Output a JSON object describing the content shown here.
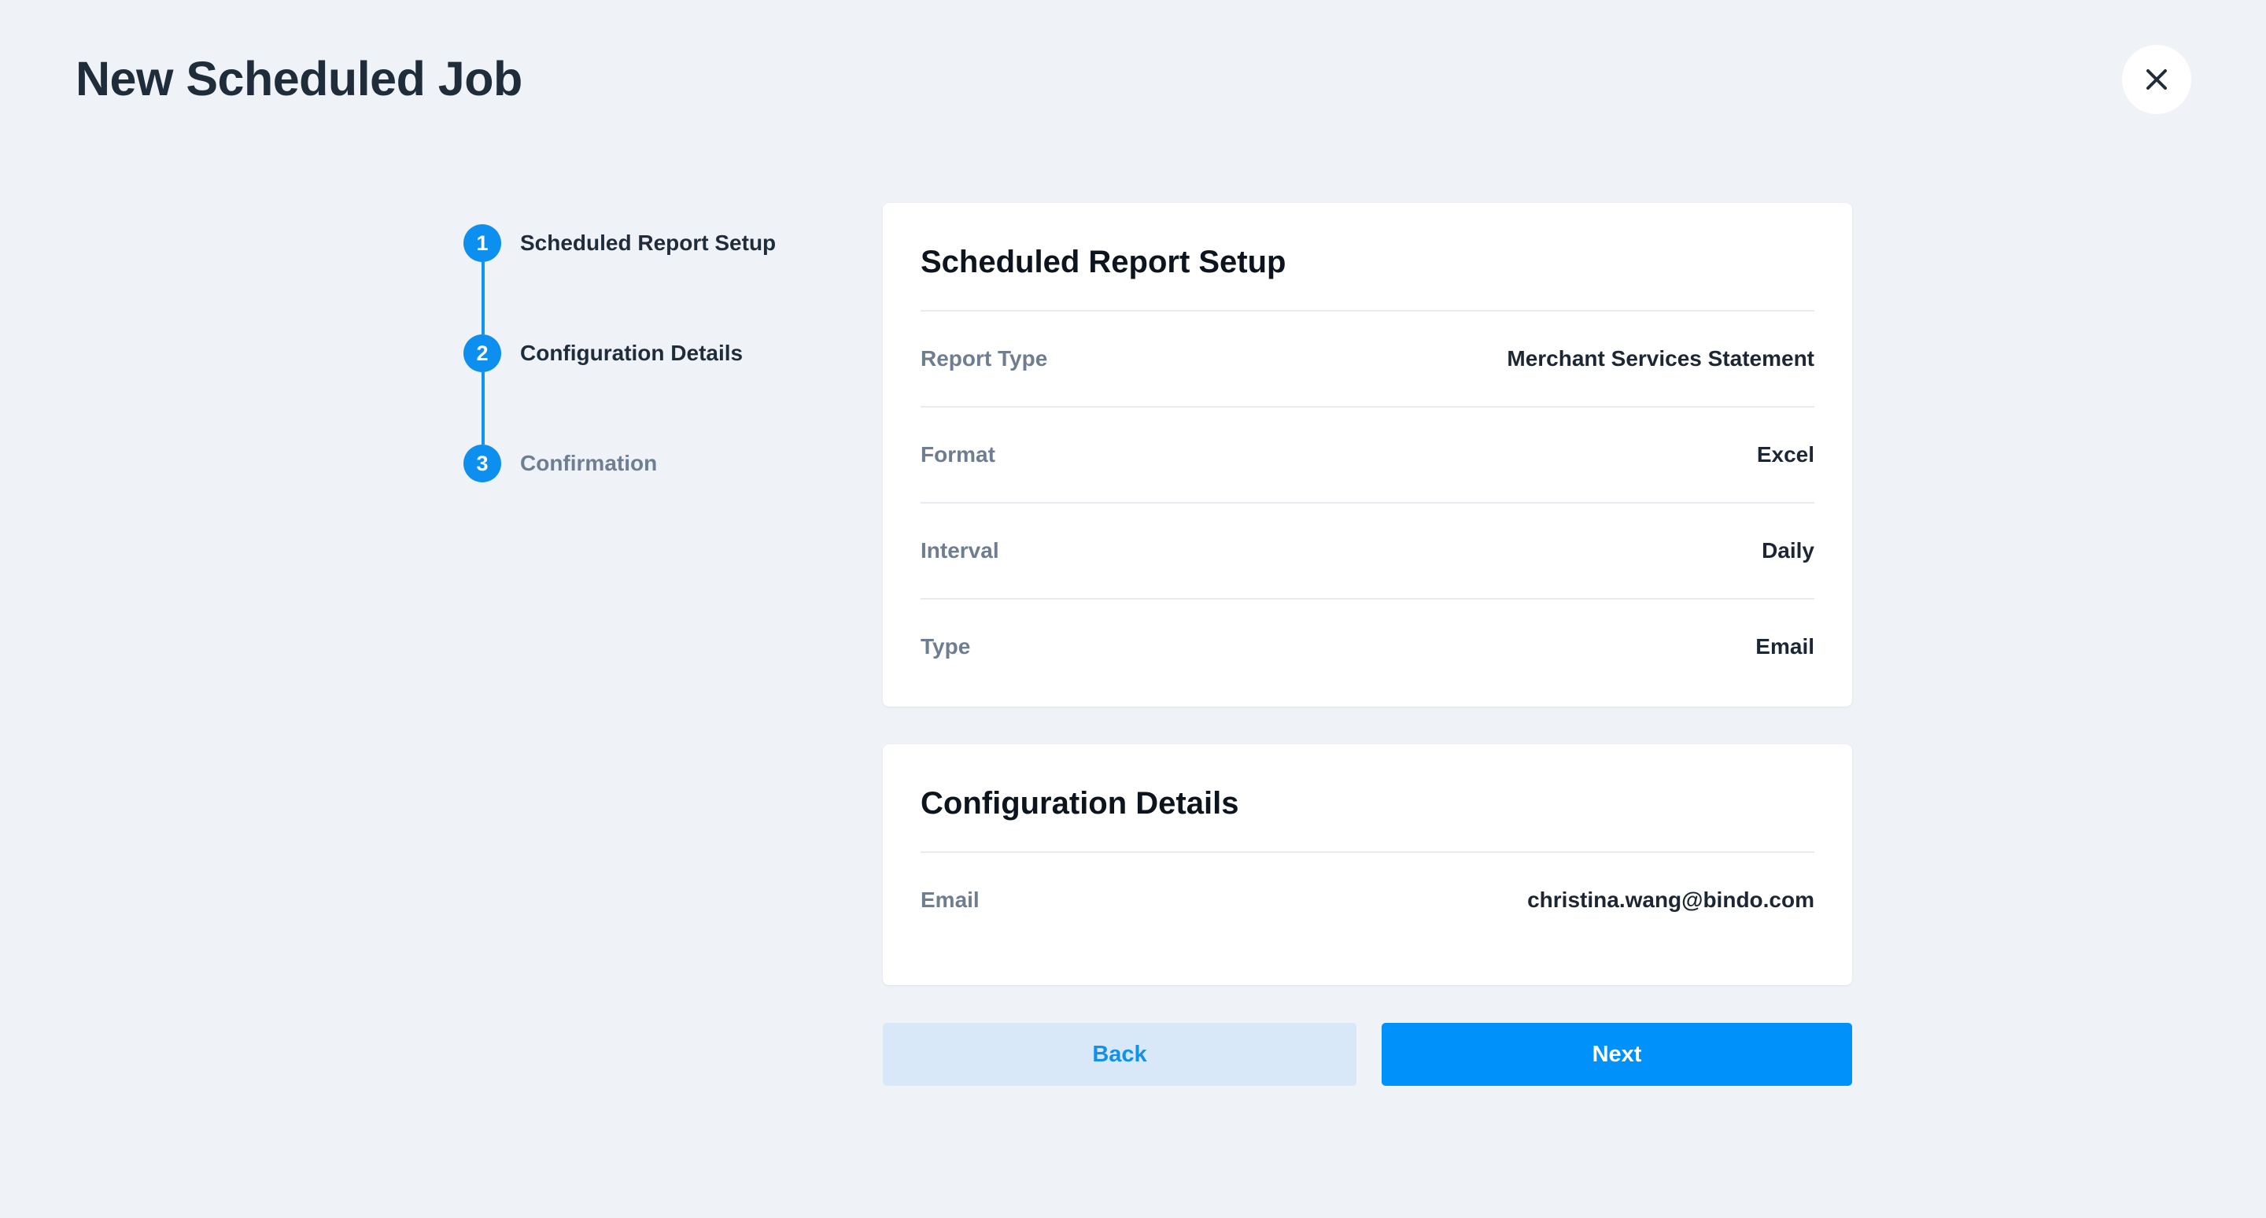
{
  "page": {
    "title": "New Scheduled Job"
  },
  "header": {
    "close_icon": "close-icon"
  },
  "stepper": {
    "steps": [
      {
        "number": "1",
        "label": "Scheduled Report Setup",
        "state": "completed"
      },
      {
        "number": "2",
        "label": "Configuration Details",
        "state": "completed"
      },
      {
        "number": "3",
        "label": "Confirmation",
        "state": "current"
      }
    ]
  },
  "setup_card": {
    "title": "Scheduled Report Setup",
    "rows": [
      {
        "label": "Report Type",
        "value": "Merchant Services Statement"
      },
      {
        "label": "Format",
        "value": "Excel"
      },
      {
        "label": "Interval",
        "value": "Daily"
      },
      {
        "label": "Type",
        "value": "Email"
      }
    ]
  },
  "config_card": {
    "title": "Configuration Details",
    "rows": [
      {
        "label": "Email",
        "value": "christina.wang@bindo.com"
      }
    ]
  },
  "actions": {
    "back_label": "Back",
    "next_label": "Next"
  },
  "colors": {
    "accent": "#0091fb",
    "background": "#eff2f7",
    "secondary_button": "#d8e8f8"
  }
}
